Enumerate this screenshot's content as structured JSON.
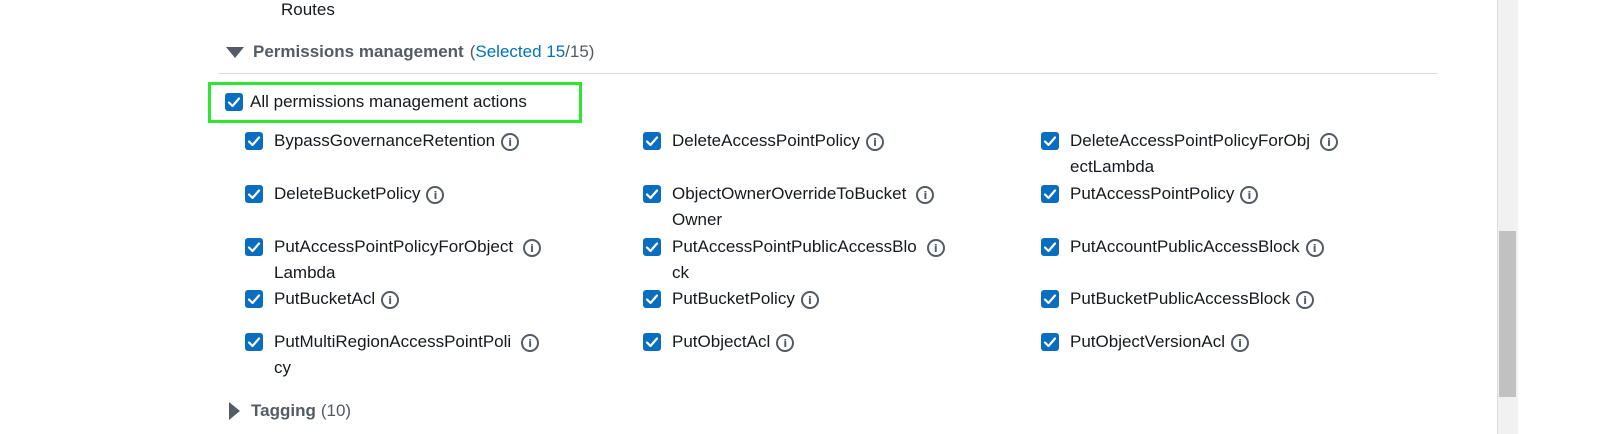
{
  "routes_text": "Routes",
  "section": {
    "title": "Permissions management",
    "count_open": "(",
    "selected_label": "Selected 15",
    "count_close": "/15)"
  },
  "select_all_label": "All permissions management actions",
  "actions": [
    {
      "line1": "BypassGovernanceRetention",
      "line2": ""
    },
    {
      "line1": "DeleteAccessPointPolicy",
      "line2": ""
    },
    {
      "line1": "DeleteAccessPointPolicyForObj",
      "line2": "ectLambda"
    },
    {
      "line1": "DeleteBucketPolicy",
      "line2": ""
    },
    {
      "line1": "ObjectOwnerOverrideToBucket",
      "line2": "Owner"
    },
    {
      "line1": "PutAccessPointPolicy",
      "line2": ""
    },
    {
      "line1": "PutAccessPointPolicyForObject",
      "line2": "Lambda"
    },
    {
      "line1": "PutAccessPointPublicAccessBlo",
      "line2": "ck"
    },
    {
      "line1": "PutAccountPublicAccessBlock",
      "line2": ""
    },
    {
      "line1": "PutBucketAcl",
      "line2": ""
    },
    {
      "line1": "PutBucketPolicy",
      "line2": ""
    },
    {
      "line1": "PutBucketPublicAccessBlock",
      "line2": ""
    },
    {
      "line1": "PutMultiRegionAccessPointPoli",
      "line2": "cy"
    },
    {
      "line1": "PutObjectAcl",
      "line2": ""
    },
    {
      "line1": "PutObjectVersionAcl",
      "line2": ""
    }
  ],
  "info_glyph": "i",
  "tagging": {
    "title": "Tagging",
    "count": "(10)"
  },
  "colors": {
    "checkbox": "#0a6ec0",
    "link": "#0073bb",
    "highlight": "#2ee62e"
  }
}
